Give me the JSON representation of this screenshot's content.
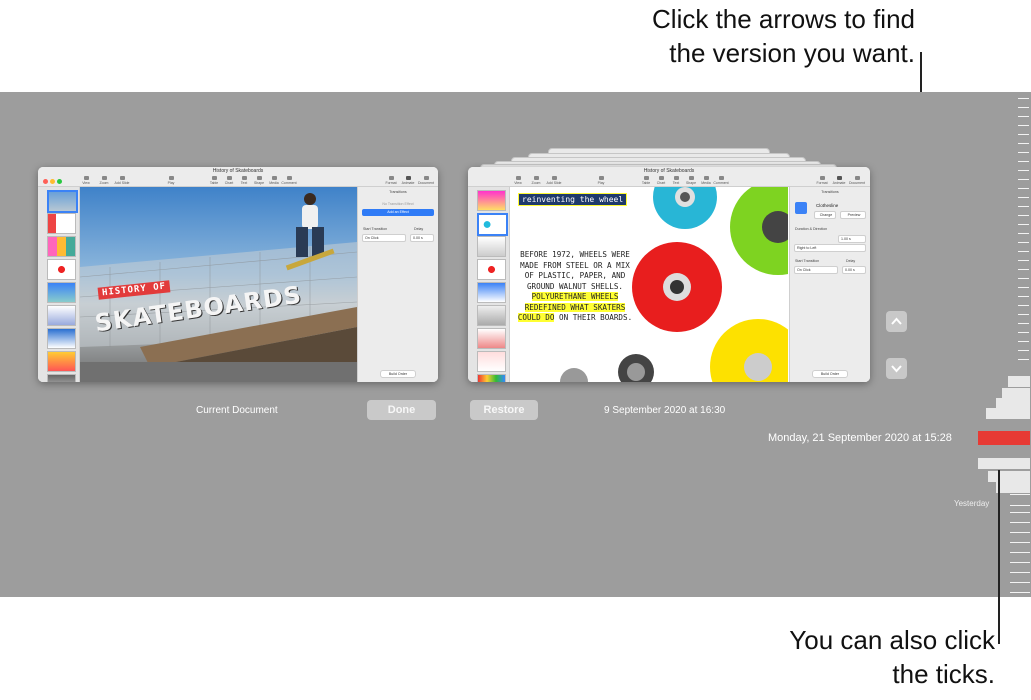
{
  "callouts": {
    "top": {
      "line1": "Click the arrows to find",
      "line2": "the version you want."
    },
    "bottom": {
      "line1": "You can also click",
      "line2": "the ticks."
    }
  },
  "current": {
    "window_title": "History of Skateboards",
    "caption": "Current Document",
    "toolbar": [
      "View",
      "Zoom",
      "Add Slide",
      "Play",
      "Table",
      "Chart",
      "Text",
      "Shape",
      "Media",
      "Comment",
      "Format",
      "Animate",
      "Document"
    ],
    "zoom": "100%",
    "slide_title_small": "HISTORY OF",
    "slide_title_big": "SKATEBOARDS",
    "panel": {
      "heading": "Transitions",
      "no_effect": "No Transition Effect",
      "add_effect": "Add an Effect",
      "start_transition": "Start Transition",
      "delay": "Delay",
      "on_click": "On Click",
      "delay_value": "0.00 s",
      "build_order": "Build Order"
    }
  },
  "version": {
    "window_title": "History of Skateboards",
    "caption": "9 September 2020  at 16:30",
    "tag": "reinventing the wheel",
    "body_normal": "BEFORE 1972, WHEELS WERE MADE FROM STEEL OR A MIX OF PLASTIC, PAPER, AND GROUND WALNUT SHELLS.",
    "body_highlight": "POLYURETHANE WHEELS REDEFINED WHAT SKATERS COULD DO",
    "body_tail": "ON THEIR BOARDS.",
    "panel": {
      "heading": "Transitions",
      "effect": "Clothesline",
      "change": "Change",
      "preview": "Preview",
      "duration": "Duration & Direction",
      "duration_value": "1.00 s",
      "direction": "Right to Left",
      "start_transition": "Start Transition",
      "delay": "Delay",
      "on_click": "On Click",
      "delay_value": "0.00 s",
      "build_order": "Build Order"
    }
  },
  "buttons": {
    "done": "Done",
    "restore": "Restore"
  },
  "timeline": {
    "selected_label": "Monday, 21 September 2020  at 15:28",
    "yesterday": "Yesterday"
  },
  "colors": {
    "stage": "#9d9d9d",
    "selected_tick": "#e73a34",
    "blue": "#2f7bf6",
    "highlight": "#ffff33"
  }
}
